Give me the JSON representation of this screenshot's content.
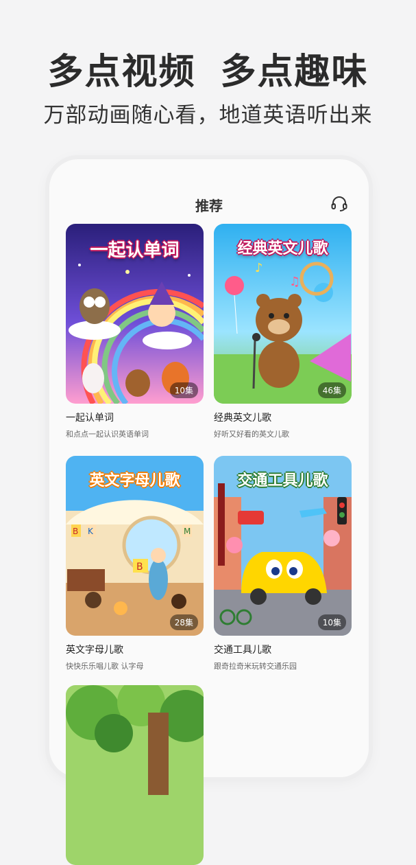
{
  "header": {
    "headline_left": "多点视频",
    "headline_right": "多点趣味",
    "subline": "万部动画随心看，地道英语听出来"
  },
  "screen": {
    "title": "推荐",
    "service_icon": "headset-icon"
  },
  "cards": [
    {
      "art_title": "一起认单词",
      "episodes": "10集",
      "title": "一起认单词",
      "subtitle": "和点点一起认识英语单词",
      "colors": [
        "#3a2a8c",
        "#7b4bd6",
        "#ff7bb0"
      ]
    },
    {
      "art_title": "经典英文儿歌",
      "episodes": "46集",
      "title": "经典英文儿歌",
      "subtitle": "好听又好看的英文儿歌",
      "colors": [
        "#36b6f0",
        "#8fe0ff",
        "#7ad05a"
      ]
    },
    {
      "art_title": "英文字母儿歌",
      "episodes": "28集",
      "title": "英文字母儿歌",
      "subtitle": "快快乐乐唱儿歌 认字母",
      "colors": [
        "#4fb3f2",
        "#f5e2b8",
        "#d9a46b"
      ]
    },
    {
      "art_title": "交通工具儿歌",
      "episodes": "10集",
      "title": "交通工具儿歌",
      "subtitle": "跟奇拉奇米玩转交通乐园",
      "colors": [
        "#5fb8f0",
        "#f7c7b0",
        "#8d8f9a"
      ]
    },
    {
      "art_title": "",
      "episodes": "",
      "title": "",
      "subtitle": "",
      "colors": [
        "#7cc24a",
        "#2f8a3a",
        "#c9e27a"
      ]
    }
  ]
}
